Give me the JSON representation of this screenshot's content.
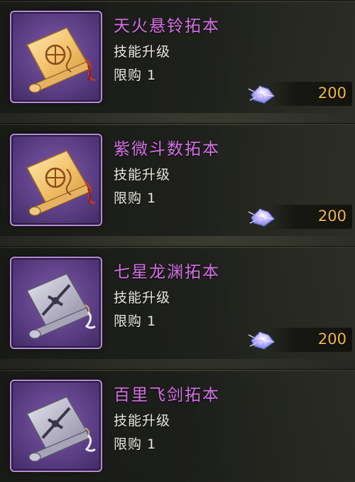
{
  "items": [
    {
      "name": "天火悬铃拓本",
      "desc": "技能升级",
      "limit": "限购 1",
      "price": "200",
      "scroll_style": "gold",
      "currency_icon": "gem-icon"
    },
    {
      "name": "紫微斗数拓本",
      "desc": "技能升级",
      "limit": "限购 1",
      "price": "200",
      "scroll_style": "gold",
      "currency_icon": "gem-icon"
    },
    {
      "name": "七星龙渊拓本",
      "desc": "技能升级",
      "limit": "限购 1",
      "price": "200",
      "scroll_style": "silver",
      "currency_icon": "gem-icon"
    },
    {
      "name": "百里飞剑拓本",
      "desc": "技能升级",
      "limit": "限购 1",
      "scroll_style": "silver"
    }
  ],
  "colors": {
    "name": "#d56fe6",
    "price": "#f0b84a",
    "frame_border": "#b58ad6",
    "frame_fill": "#5d3f86"
  }
}
